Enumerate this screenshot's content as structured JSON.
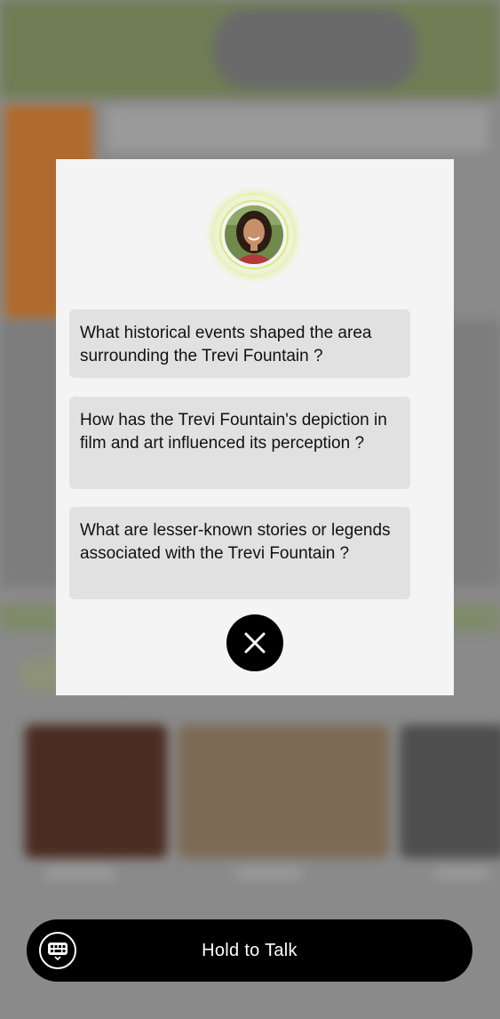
{
  "modal": {
    "questions": [
      "What historical events shaped the area surrounding the Trevi Fountain ?",
      "How has the Trevi Fountain's depiction in film and art influenced its perception ?",
      "What are lesser-known stories or legends associated with the Trevi Fountain ?"
    ],
    "icons": {
      "close": "close-icon",
      "avatar": "avatar"
    }
  },
  "bottom_bar": {
    "talk_label": "Hold to Talk",
    "keyboard_icon": "keyboard-icon"
  },
  "colors": {
    "modal_bg": "#f4f4f4",
    "question_bg": "#e1e1e1",
    "accent_ring": "#d9eb7a",
    "bar_bg": "#000000"
  }
}
